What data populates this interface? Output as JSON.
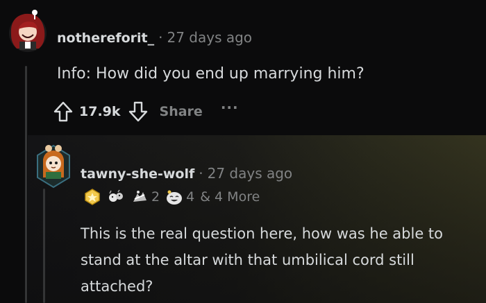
{
  "comment": {
    "username": "nothereforit_",
    "separator": "·",
    "time": "27 days ago",
    "body": "Info: How did you end up marrying him?",
    "score": "17.9k",
    "share_label": "Share",
    "more_label": "···"
  },
  "reply": {
    "username": "tawny-she-wolf",
    "separator": "·",
    "time": "27 days ago",
    "awards": [
      {
        "icon": "helpful-award-icon"
      },
      {
        "icon": "wholesome-award-icon"
      },
      {
        "icon": "hugz-award-icon",
        "count": "2"
      },
      {
        "icon": "laughing-award-icon",
        "count": "4"
      }
    ],
    "more_awards": "& 4 More",
    "body_lines": [
      "This is the real question here, how was he able to",
      "stand at the altar with that umbilical cord still",
      "attached?"
    ]
  },
  "colors": {
    "background": "#0b0b0c",
    "text": "#d7dadc",
    "muted": "#818384",
    "highlight": "#34331f"
  }
}
